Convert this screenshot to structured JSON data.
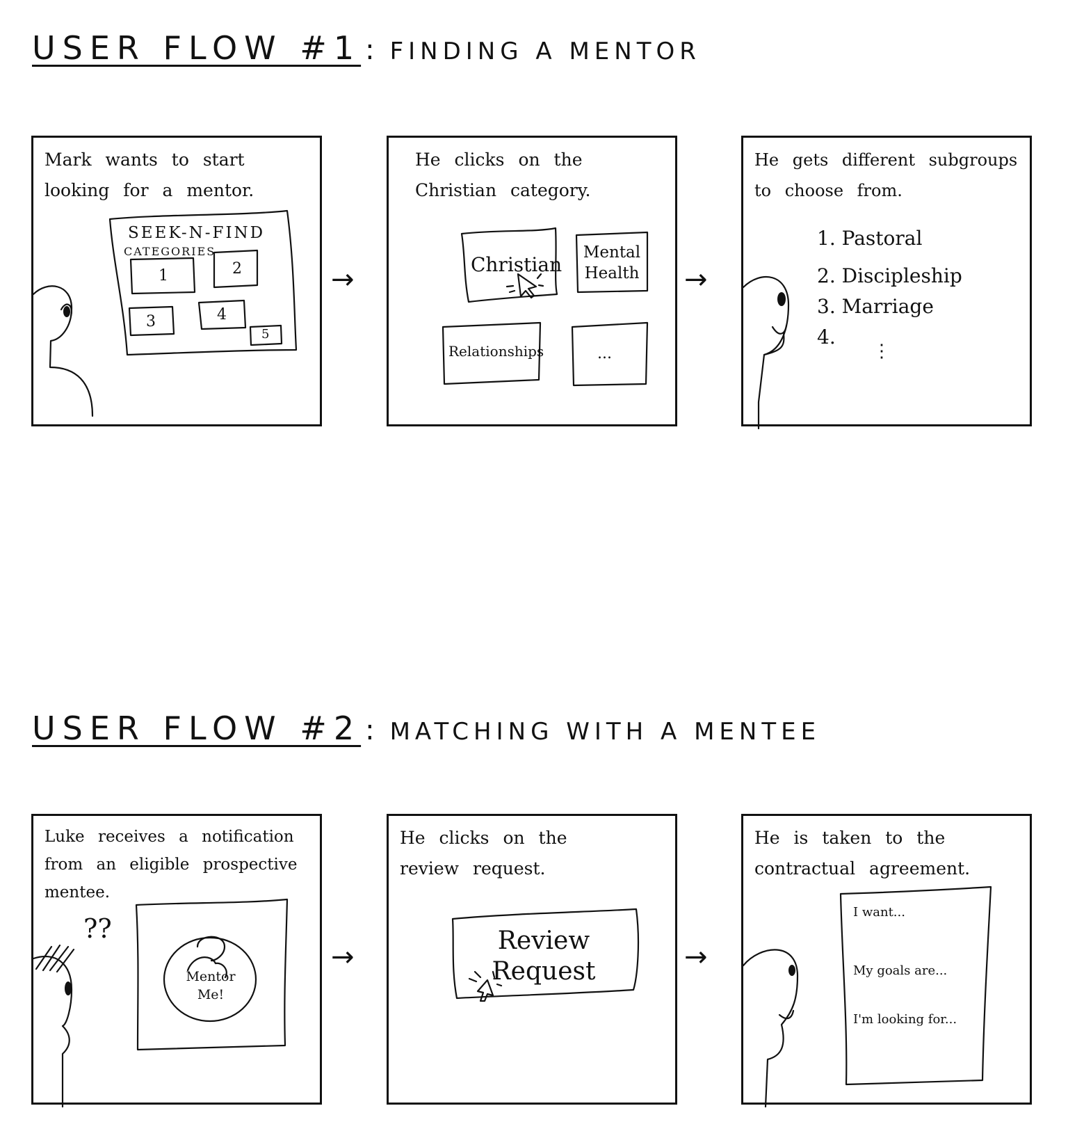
{
  "flow1": {
    "title": "USER FLOW #1",
    "subtitle": "FINDING A MENTOR",
    "panel1": {
      "caption": "Mark wants to start looking for a mentor.",
      "screen_title": "SEEK-N-FIND",
      "screen_subtitle": "CATEGORIES",
      "tiles": [
        "1",
        "2",
        "3",
        "4",
        "5"
      ]
    },
    "panel2": {
      "caption": "He clicks on the Christian category.",
      "tiles": [
        "Christian",
        "Mental Health",
        "Relationships",
        "..."
      ]
    },
    "panel3": {
      "caption": "He gets different subgroups to choose from.",
      "items": [
        "1. Pastoral",
        "2. Discipleship",
        "3. Marriage",
        "4.",
        "⋮"
      ]
    }
  },
  "flow2": {
    "title": "USER FLOW #2",
    "subtitle": "MATCHING WITH A MENTEE",
    "panel1": {
      "caption": "Luke receives a notification from an eligible prospective mentee.",
      "thought": "??",
      "avatar_text": "Mentor Me!"
    },
    "panel2": {
      "caption": "He clicks on the review request.",
      "button": "Review Request"
    },
    "panel3": {
      "caption": "He is taken to the contractual agreement.",
      "lines": [
        "I want...",
        "My goals are...",
        "I'm looking for..."
      ]
    }
  },
  "arrow_glyph": "→"
}
